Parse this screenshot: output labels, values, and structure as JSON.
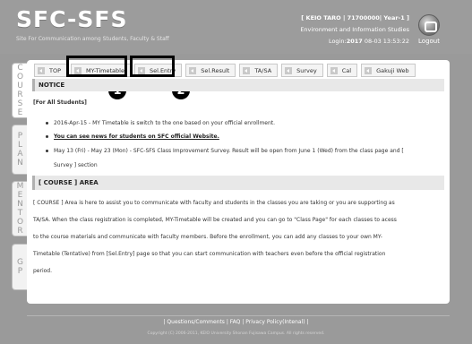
{
  "header": {
    "logo": "SFC-SFS",
    "subtitle": "Site For Communication among Students, Faculty & Staff",
    "user_line": "[ KEIO TARO | 71700000| Year-1 ]",
    "dept_line": "Environment and Information Studies",
    "login_prefix": "Login:",
    "login_year": "2017",
    "login_rest": " 08-03 13:53:22",
    "logout_label": "Logout"
  },
  "side_tabs": [
    {
      "letters": [
        "C",
        "O",
        "U",
        "R",
        "S",
        "E"
      ]
    },
    {
      "letters": [
        "P",
        "L",
        "A",
        "N"
      ]
    },
    {
      "letters": [
        "M",
        "E",
        "N",
        "T",
        "O",
        "R"
      ]
    },
    {
      "letters": [
        "G",
        "P"
      ]
    }
  ],
  "nav": {
    "items": [
      "TOP",
      "MY-Timetable",
      "Sel.Entry",
      "Sel.Result",
      "TA/SA",
      "Survey",
      "Cal",
      "Gakuji Web"
    ],
    "badges": [
      "1",
      "2"
    ]
  },
  "notice": {
    "heading": "NOTICE",
    "for_label": "[For All Students]",
    "bullet1": "2016-Apr-15 - MY Timetable is switch to the one based on your official enrollment.",
    "bullet2": "You can see news for students on SFC official Website.",
    "bullet3_line1": "May 13 (Fri) - May 23 (Mon) - SFC-SFS Class Improvement Survey. Result will be open from June 1 (Wed) from the class page and [",
    "bullet3_line2": "Survey ] section"
  },
  "course": {
    "heading": "[ COURSE ] AREA",
    "lines": [
      "[ COURSE ] Area is here to assist you to communicate with faculty and students in the classes you are taking or you are supporting as",
      "TA/SA. When the class registration is completed, MY-Timetable will be created and you can go to \"Class Page\" for each classes to acess",
      "to the course materials and communicate with faculty members. Before the enrollment, you can add any classes to your own MY-",
      "Timetable (Tentative) from [Sel.Entry] page so that you can start communication with teachers even before the official registration",
      "period."
    ]
  },
  "footer": {
    "links": "| Questions/Comments | FAQ | Privacy Policy(Intenal) |",
    "copyright": "Copyright (C) 2006-2011, KEIO University Shonan Fujisawa Campus. All rights reserved."
  }
}
